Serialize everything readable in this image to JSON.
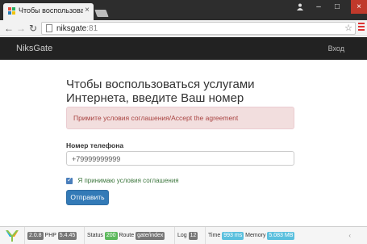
{
  "browser": {
    "tab_title": "Чтобы воспользоваться",
    "tab_close": "×",
    "minimize": "–",
    "maximize": "□",
    "close": "×",
    "url_host": "niksgate",
    "url_port": ":81",
    "star": "☆",
    "back": "←",
    "forward": "→",
    "reload": "↻"
  },
  "navbar": {
    "brand": "NiksGate",
    "login": "Вход"
  },
  "main": {
    "heading": "Чтобы воспользоваться услугами Интернета, введите Ваш номер телефона",
    "alert": "Примите условия соглашения/Accept the agreement",
    "phone_label": "Номер телефона",
    "phone_value": "+79999999999",
    "agree_label": "Я принимаю условия соглашения",
    "agree_checked": true,
    "submit_label": "Отправить"
  },
  "debug": {
    "yii_version": "2.0.8",
    "php_label": "PHP",
    "php_version": "5.4.45",
    "status_label": "Status",
    "status_value": "200",
    "route_label": "Route",
    "route_value": "gate/index",
    "log_label": "Log",
    "log_value": "12",
    "time_label": "Time",
    "time_value": "993 ms",
    "memory_label": "Memory",
    "memory_value": "5.083 MB",
    "collapse": "‹"
  }
}
